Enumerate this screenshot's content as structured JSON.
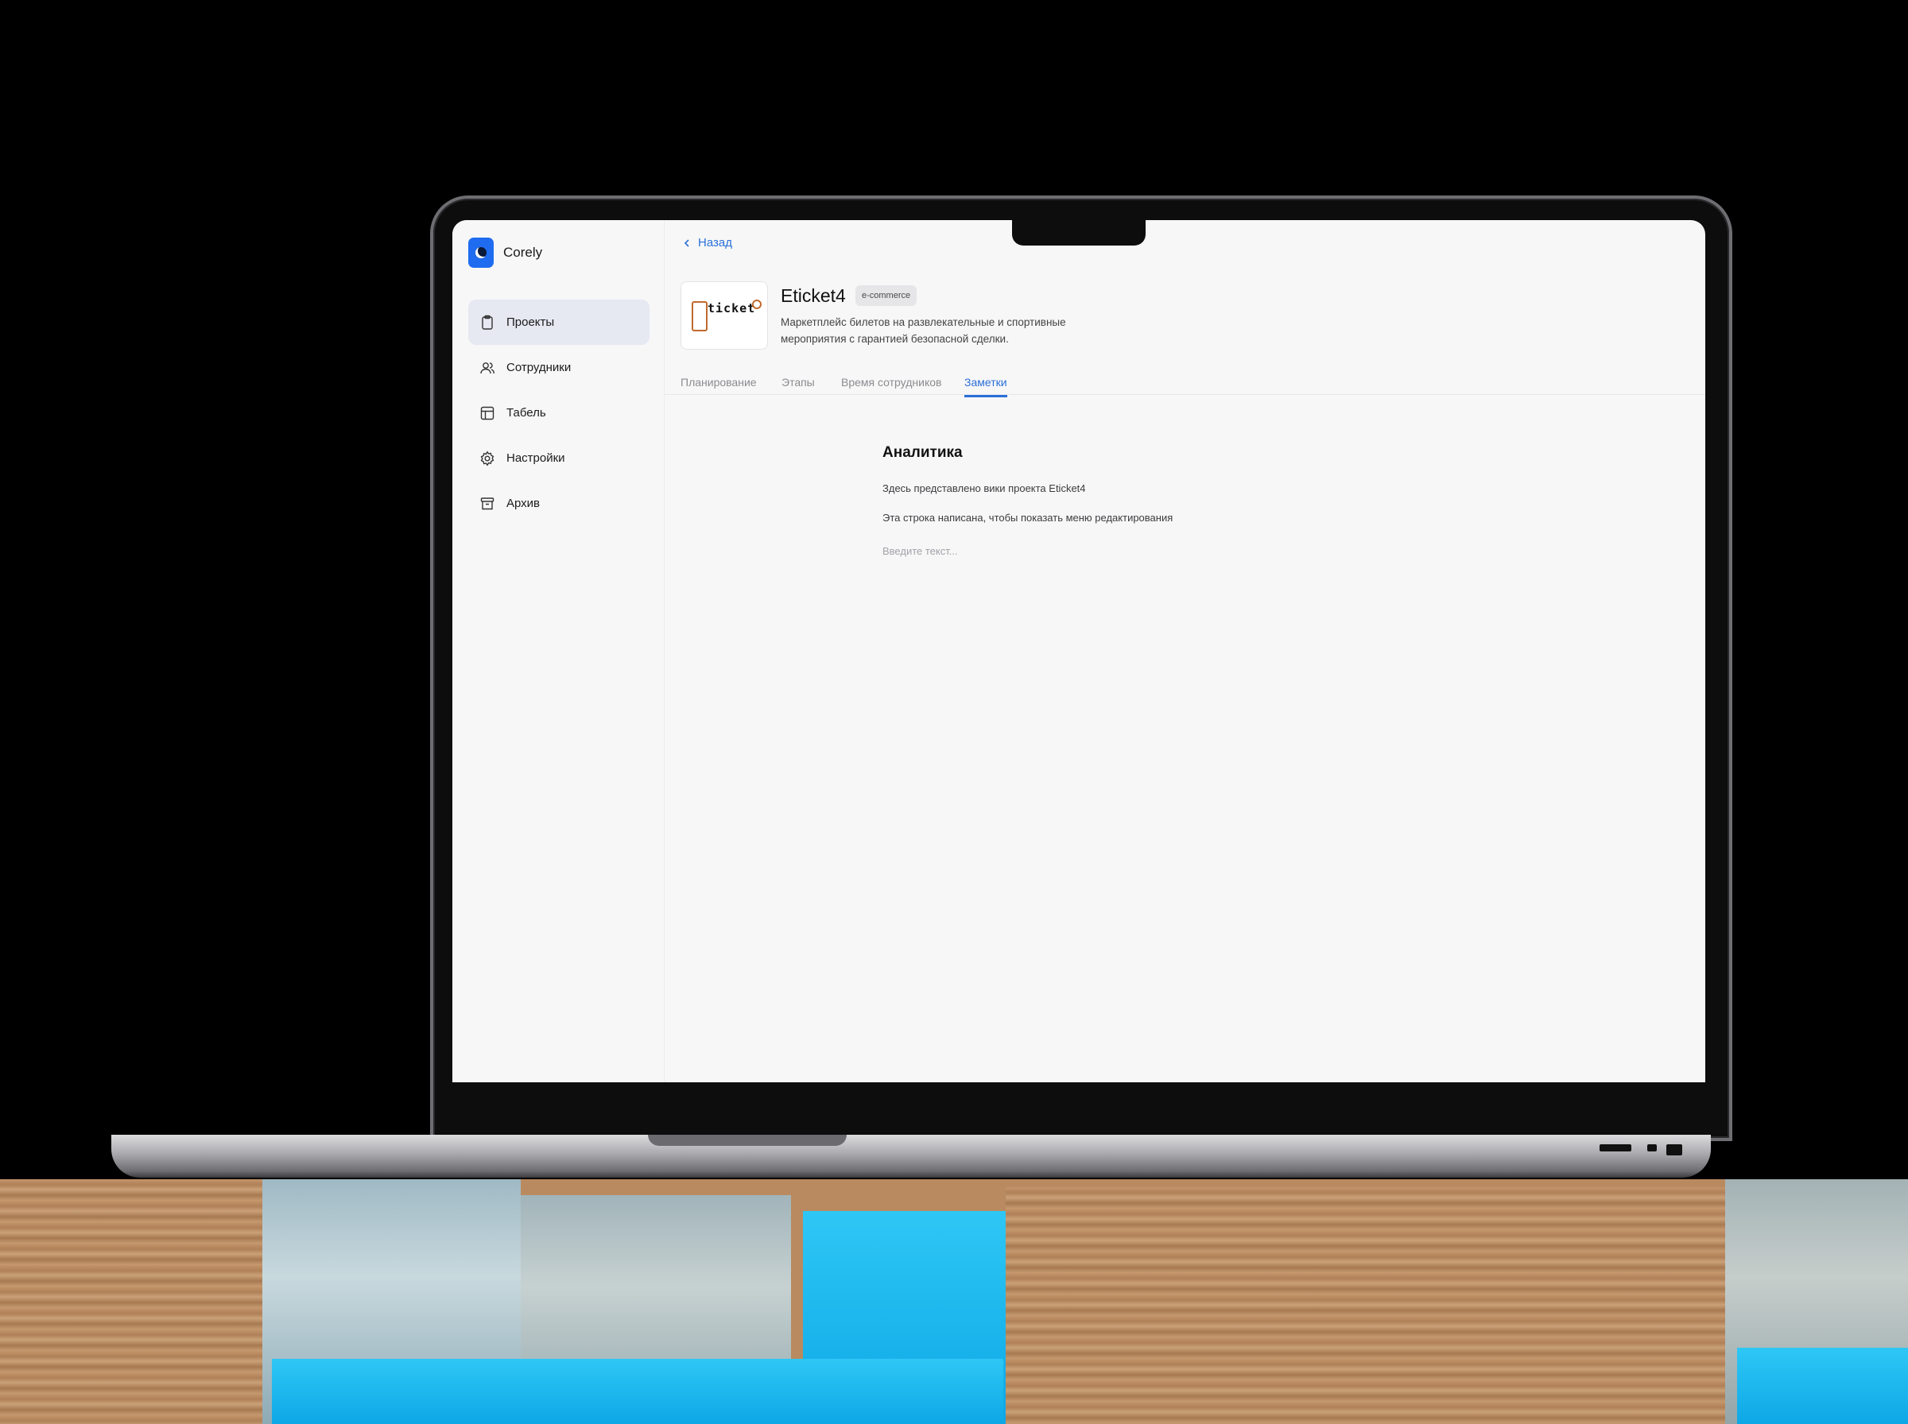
{
  "app": {
    "name": "Corely"
  },
  "sidebar": {
    "items": [
      {
        "label": "Проекты",
        "icon": "clipboard-icon",
        "active": true
      },
      {
        "label": "Сотрудники",
        "icon": "users-icon",
        "active": false
      },
      {
        "label": "Табель",
        "icon": "table-icon",
        "active": false
      },
      {
        "label": "Настройки",
        "icon": "gear-icon",
        "active": false
      },
      {
        "label": "Архив",
        "icon": "archive-icon",
        "active": false
      }
    ]
  },
  "header": {
    "back_label": "Назад",
    "project_title": "Eticket4",
    "project_badge": "e-commerce",
    "project_description": "Маркетплейс билетов на развлекательные и спортивные мероприятия с гарантией безопасной сделки.",
    "logo_text": "ticket",
    "logo_letter": "e"
  },
  "tabs": [
    {
      "label": "Планирование",
      "active": false
    },
    {
      "label": "Этапы",
      "active": false
    },
    {
      "label": "Время сотрудников",
      "active": false
    },
    {
      "label": "Заметки",
      "active": true
    }
  ],
  "note": {
    "title": "Аналитика",
    "lines": [
      "Здесь представлено вики проекта Eticket4",
      "Эта строка написана, чтобы показать меню редактирования"
    ],
    "input_placeholder": "Введите текст..."
  },
  "colors": {
    "accent": "#2a6fd8",
    "active_nav_bg": "#e6e8f2",
    "brand": "#1f6cf0"
  }
}
